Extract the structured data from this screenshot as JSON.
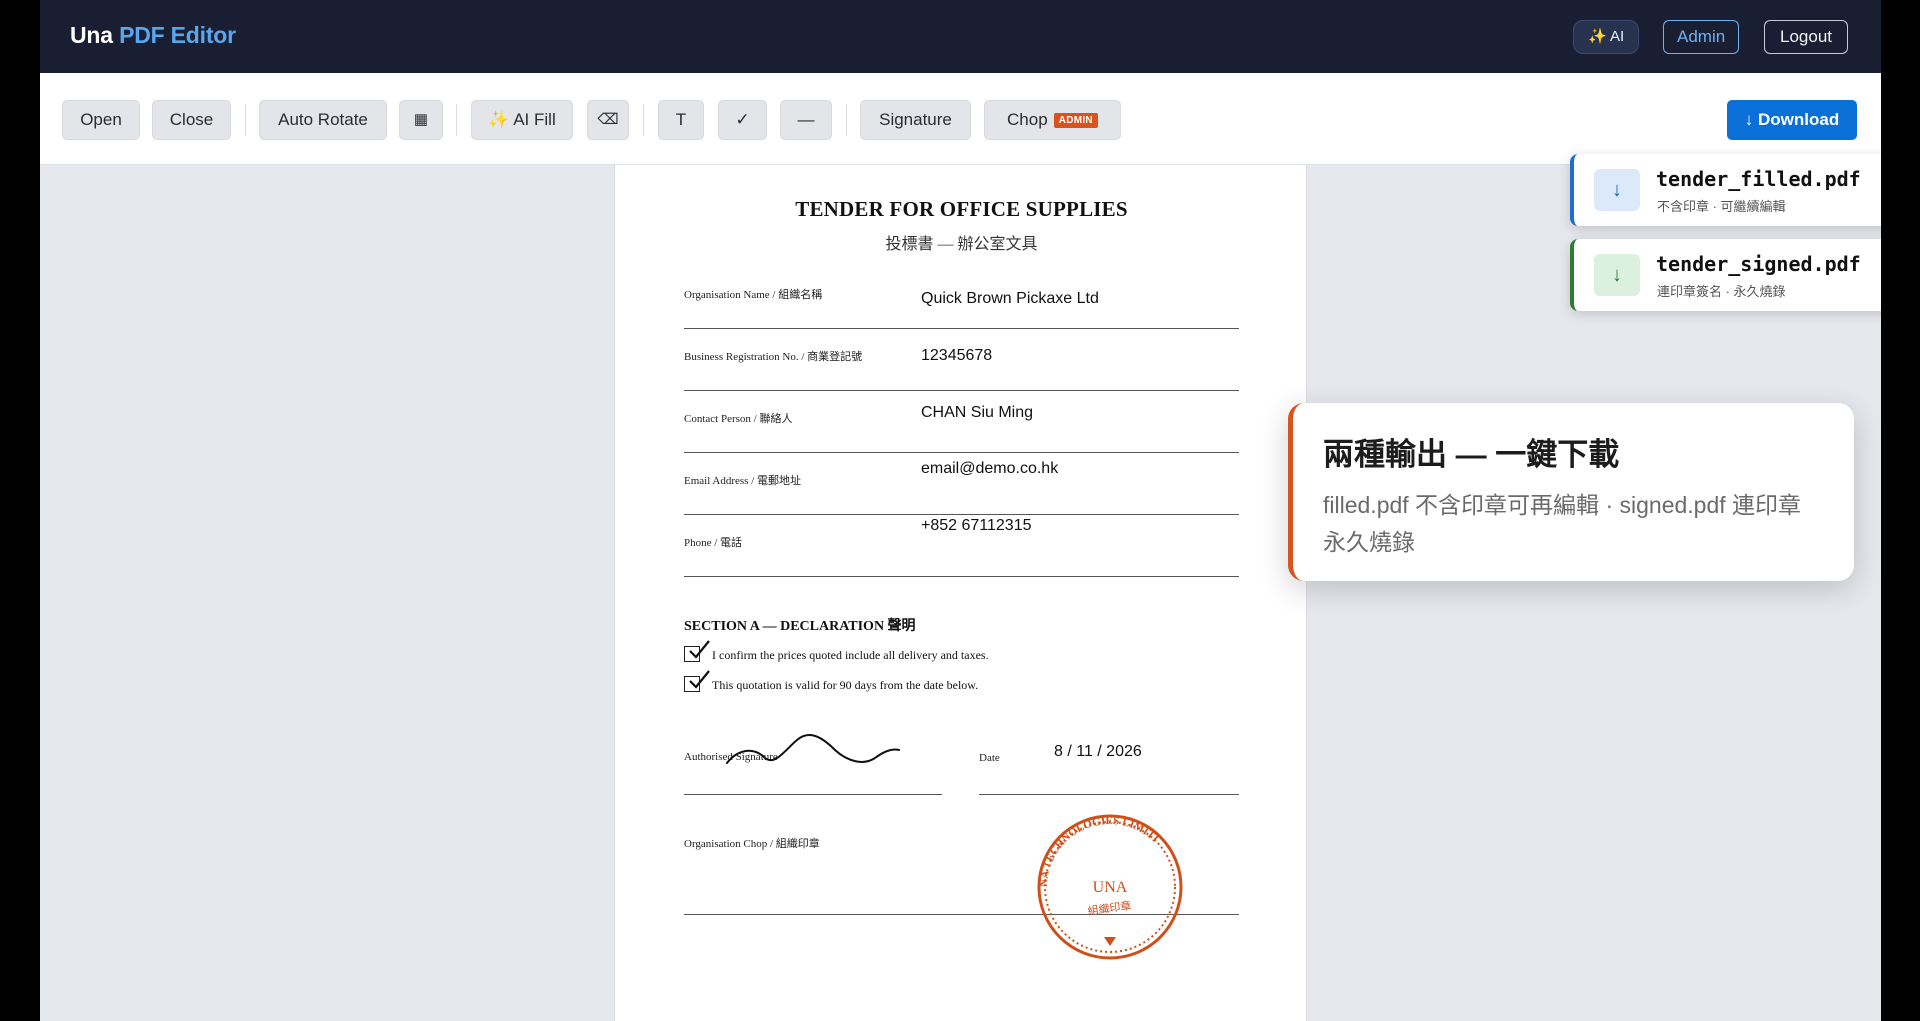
{
  "navbar": {
    "brand_plain": "Una",
    "brand_accent": "PDF Editor",
    "ai_label": "✨ AI",
    "admin_label": "Admin",
    "logout_label": "Logout"
  },
  "toolbar": {
    "open": "Open",
    "close": "Close",
    "auto_rotate": "Auto Rotate",
    "grid_icon": "▦",
    "ai_fill": "✨ AI Fill",
    "erase_icon": "⌫",
    "text_tool": "T",
    "check_tool": "✓",
    "line_tool": "—",
    "signature": "Signature",
    "chop": "Chop",
    "chop_badge": "ADMIN",
    "download": "↓ Download"
  },
  "document": {
    "title": "TENDER FOR OFFICE SUPPLIES",
    "subtitle": "投標書 — 辦公室文具",
    "fields": [
      {
        "label": "Organisation Name / 組織名稱",
        "value": "Quick Brown Pickaxe Ltd"
      },
      {
        "label": "Business Registration No. / 商業登記號",
        "value": "12345678"
      },
      {
        "label": "Contact Person / 聯絡人",
        "value": "CHAN Siu Ming"
      },
      {
        "label": "Email Address / 電郵地址",
        "value": "email@demo.co.hk"
      },
      {
        "label": "Phone / 電話",
        "value": "+852 67112315"
      }
    ],
    "section_heading": "SECTION A — DECLARATION 聲明",
    "declarations": [
      {
        "text": "I confirm the prices quoted include all delivery and taxes.",
        "checked": true
      },
      {
        "text": "This quotation is valid for 90 days from the date below.",
        "checked": true
      }
    ],
    "signature_label": "Authorised Signature",
    "date_label": "Date",
    "date_value": "8 / 11 / 2026",
    "chop_label": "Organisation Chop / 組織印章",
    "stamp": {
      "ring_text": "NA TECHNOLOGIES LIMITI",
      "center_text": "UNA",
      "sub_text": "組織印章",
      "color": "#cf4f18"
    }
  },
  "downloads": [
    {
      "icon": "↓",
      "name": "tender_filled.pdf",
      "note": "不含印章 · 可繼續編輯",
      "accent": "#1e6fd0"
    },
    {
      "icon": "↓",
      "name": "tender_signed.pdf",
      "note": "連印章簽名 · 永久燒錄",
      "accent": "#2e7d32"
    }
  ],
  "callout": {
    "title": "兩種輸出 — 一鍵下載",
    "body": "filled.pdf 不含印章可再編輯 · signed.pdf 連印章永久燒錄"
  }
}
